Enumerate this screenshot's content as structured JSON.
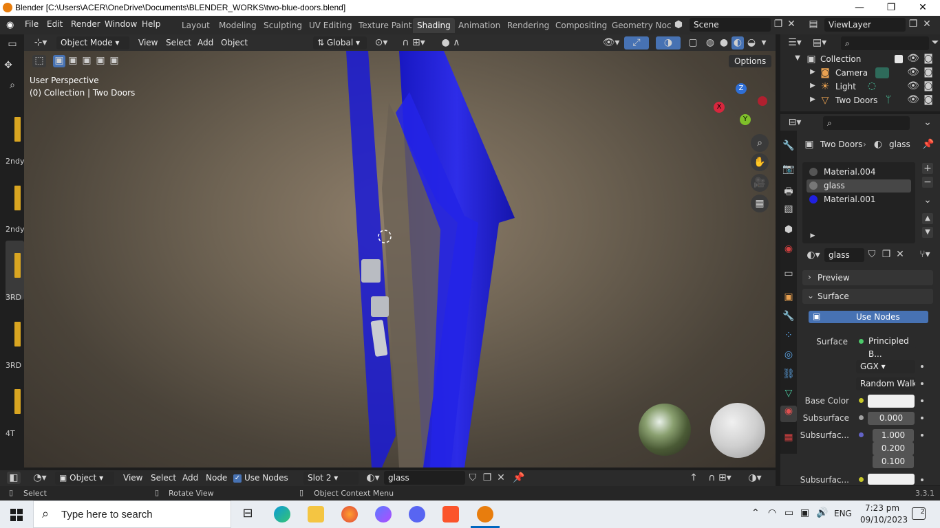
{
  "window": {
    "title": "Blender [C:\\Users\\ACER\\OneDrive\\Documents\\BLENDER_WORKS\\two-blue-doors.blend]",
    "min": "—",
    "max": "❐",
    "close": "✕"
  },
  "menus": [
    "File",
    "Edit",
    "Render",
    "Window",
    "Help"
  ],
  "workspaces": [
    "Layout",
    "Modeling",
    "Sculpting",
    "UV Editing",
    "Texture Paint",
    "Shading",
    "Animation",
    "Rendering",
    "Compositing",
    "Geometry Noc"
  ],
  "active_workspace": "Shading",
  "scene": "Scene",
  "view_layer": "ViewLayer",
  "viewport": {
    "mode": "Object Mode",
    "menus": [
      "View",
      "Select",
      "Add",
      "Object"
    ],
    "orientation": "Global",
    "options": "Options",
    "overlay_line1": "User Perspective",
    "overlay_line2": "(0) Collection | Two Doors",
    "gizmo": {
      "z": "Z",
      "x": "X",
      "y": "Y"
    }
  },
  "left_labels": [
    "2ndy",
    "2ndy",
    "3RD",
    "3RD",
    "4T"
  ],
  "outliner": {
    "rows": [
      {
        "label": "Collection"
      },
      {
        "label": "Camera"
      },
      {
        "label": "Light"
      },
      {
        "label": "Two Doors"
      }
    ]
  },
  "properties": {
    "breadcrumb_object": "Two Doors",
    "breadcrumb_material": "glass",
    "materials": [
      "Material.004",
      "glass",
      "Material.001"
    ],
    "material_name": "glass",
    "preview": "Preview",
    "surface": "Surface",
    "use_nodes": "Use Nodes",
    "surface_label": "Surface",
    "surface_value": "Principled B...",
    "distribution": "GGX",
    "subsurface_method": "Random Walk",
    "base_color_label": "Base Color",
    "subsurface_label": "Subsurface",
    "subsurface_value": "0.000",
    "subsurface_radius_label": "Subsurfac...",
    "radius": [
      "1.000",
      "0.200",
      "0.100"
    ],
    "subsurface_color_label": "Subsurfac..."
  },
  "nodebar": {
    "editor": "Object",
    "menus": [
      "View",
      "Select",
      "Add",
      "Node"
    ],
    "use_nodes": "Use Nodes",
    "slot": "Slot 2",
    "material": "glass"
  },
  "status": {
    "select": "Select",
    "rotate": "Rotate View",
    "context": "Object Context Menu",
    "version": "3.3.1"
  },
  "taskbar": {
    "search": "Type here to search",
    "lang": "ENG",
    "time": "7:23 pm",
    "date": "09/10/2023",
    "notif": "2"
  }
}
